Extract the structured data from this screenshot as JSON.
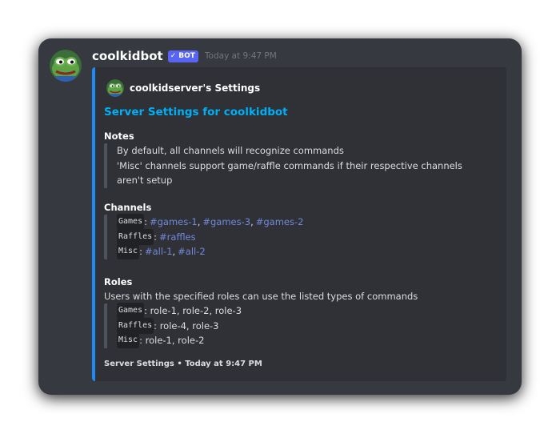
{
  "message": {
    "username": "coolkidbot",
    "bot_tag": "BOT",
    "bot_check": "✓",
    "timestamp": "Today at 9:47 PM",
    "avatar_icon": "pepe-frog-icon"
  },
  "embed": {
    "accent_color": "#1d8bf1",
    "author": {
      "name": "coolkidserver's Settings",
      "icon": "pepe-frog-icon"
    },
    "title": "Server Settings for coolkidbot",
    "notes": {
      "name": "Notes",
      "lines": [
        "By default, all channels will recognize commands",
        "'Misc' channels support game/raffle commands if their respective channels",
        "aren't setup"
      ]
    },
    "channels": {
      "name": "Channels",
      "rows": [
        {
          "label": "Games",
          "channels": [
            "#games-1",
            "#games-3",
            "#games-2"
          ]
        },
        {
          "label": "Raffles",
          "channels": [
            "#raffles"
          ]
        },
        {
          "label": "Misc",
          "channels": [
            "#all-1",
            "#all-2"
          ]
        }
      ]
    },
    "roles": {
      "name": "Roles",
      "description": "Users with the specified roles can use the listed types of commands",
      "rows": [
        {
          "label": "Games",
          "value": "role-1, role-2, role-3"
        },
        {
          "label": "Raffles",
          "value": "role-4, role-3"
        },
        {
          "label": "Misc",
          "value": "role-1, role-2"
        }
      ]
    },
    "footer": {
      "text": "Server Settings",
      "separator": "•",
      "timestamp": "Today at 9:47 PM"
    }
  },
  "colors": {
    "background": "#36393f",
    "embed_background": "#2f3136",
    "link": "#00aff4",
    "mention": "#7289da",
    "bot_tag": "#5865f2"
  }
}
